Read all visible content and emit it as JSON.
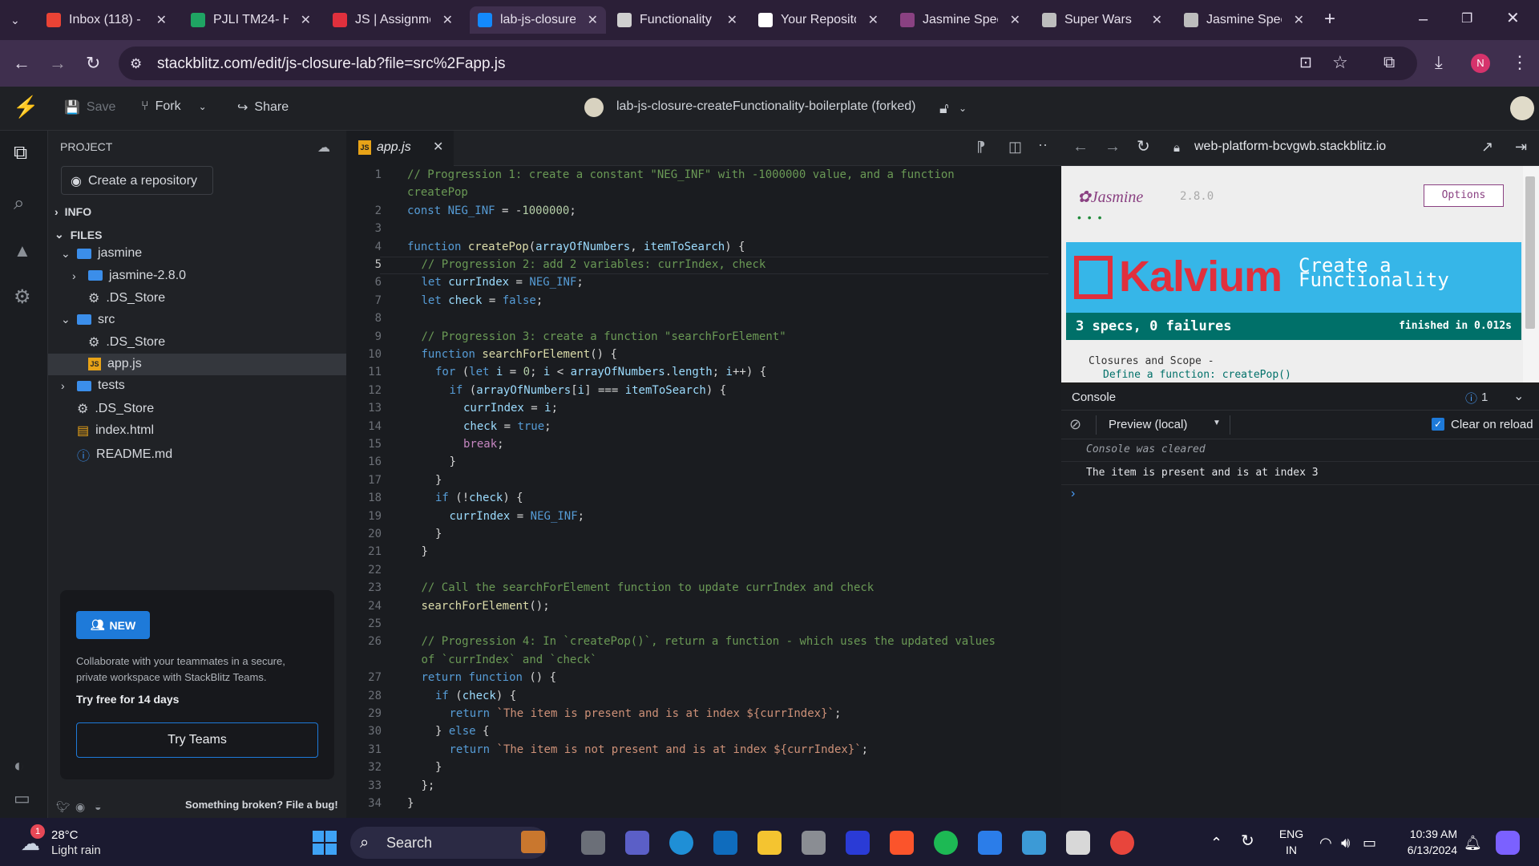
{
  "browser": {
    "tabs": [
      {
        "title": "Inbox (118) -",
        "icon": "gmail-icon",
        "color": "#ea4335"
      },
      {
        "title": "PJLI TM24- H",
        "icon": "sheets-icon",
        "color": "#1fa463"
      },
      {
        "title": "JS | Assignme",
        "icon": "kalvium-icon",
        "color": "#e0303d"
      },
      {
        "title": "lab-js-closure",
        "icon": "stackblitz-icon",
        "color": "#1389fd",
        "active": true
      },
      {
        "title": "Functionality",
        "icon": "chatgpt-icon",
        "color": "#cfcfcf"
      },
      {
        "title": "Your Reposito",
        "icon": "github-icon",
        "color": "#ffffff"
      },
      {
        "title": "Jasmine Spec",
        "icon": "jasmine-icon",
        "color": "#8a4182"
      },
      {
        "title": "Super Wars",
        "icon": "globe-icon",
        "color": "#bdbdbd"
      },
      {
        "title": "Jasmine Spec",
        "icon": "globe-icon",
        "color": "#bdbdbd"
      }
    ],
    "url": "stackblitz.com/edit/js-closure-lab?file=src%2Fapp.js",
    "profile_initial": "N"
  },
  "stackblitz": {
    "save_label": "Save",
    "fork_label": "Fork",
    "share_label": "Share",
    "project_title": "lab-js-closure-createFunctionality-boilerplate (forked)"
  },
  "sidebar": {
    "project_label": "PROJECT",
    "create_repo_label": "Create a repository",
    "info_label": "INFO",
    "files_label": "FILES",
    "tree": [
      {
        "name": "jasmine",
        "type": "folder",
        "depth": 1,
        "open": true
      },
      {
        "name": "jasmine-2.8.0",
        "type": "folder",
        "depth": 2,
        "open": false
      },
      {
        "name": ".DS_Store",
        "type": "gear",
        "depth": 2
      },
      {
        "name": "src",
        "type": "folder",
        "depth": 1,
        "open": true
      },
      {
        "name": ".DS_Store",
        "type": "gear",
        "depth": 2
      },
      {
        "name": "app.js",
        "type": "js",
        "depth": 2,
        "selected": true
      },
      {
        "name": "tests",
        "type": "folder",
        "depth": 1,
        "open": false
      },
      {
        "name": ".DS_Store",
        "type": "gear",
        "depth": 1
      },
      {
        "name": "index.html",
        "type": "html",
        "depth": 1
      },
      {
        "name": "README.md",
        "type": "info",
        "depth": 1
      }
    ],
    "promo": {
      "badge": "NEW",
      "text": "Collaborate with your teammates in a secure, private workspace with StackBlitz Teams.",
      "trial": "Try free for 14 days",
      "button": "Try Teams"
    },
    "footer_link": "Something broken? File a bug!"
  },
  "editor": {
    "tab_label": "app.js",
    "lines": [
      {
        "n": "1",
        "t": "// Progression 1: create a constant \"NEG_INF\" with -1000000 value, and a function",
        "c": "cm",
        "i": 0
      },
      {
        "n": "",
        "t": "createPop",
        "c": "cm",
        "i": 0
      },
      {
        "n": "2",
        "t": "const NEG_INF = -1000000;",
        "c": "code",
        "i": 0
      },
      {
        "n": "3",
        "t": "",
        "c": "code",
        "i": 0
      },
      {
        "n": "4",
        "t": "function createPop(arrayOfNumbers, itemToSearch) {",
        "c": "code",
        "i": 0
      },
      {
        "n": "5",
        "t": "// Progression 2: add 2 variables: currIndex, check",
        "c": "cm",
        "i": 1
      },
      {
        "n": "6",
        "t": "let currIndex = NEG_INF;",
        "c": "code",
        "i": 1
      },
      {
        "n": "7",
        "t": "let check = false;",
        "c": "code",
        "i": 1
      },
      {
        "n": "8",
        "t": "",
        "c": "code",
        "i": 1
      },
      {
        "n": "9",
        "t": "// Progression 3: create a function \"searchForElement\"",
        "c": "cm",
        "i": 1
      },
      {
        "n": "10",
        "t": "function searchForElement() {",
        "c": "code",
        "i": 1
      },
      {
        "n": "11",
        "t": "for (let i = 0; i < arrayOfNumbers.length; i++) {",
        "c": "code",
        "i": 2
      },
      {
        "n": "12",
        "t": "if (arrayOfNumbers[i] === itemToSearch) {",
        "c": "code",
        "i": 3
      },
      {
        "n": "13",
        "t": "currIndex = i;",
        "c": "code",
        "i": 4
      },
      {
        "n": "14",
        "t": "check = true;",
        "c": "code",
        "i": 4
      },
      {
        "n": "15",
        "t": "break;",
        "c": "ctl",
        "i": 4
      },
      {
        "n": "16",
        "t": "}",
        "c": "code",
        "i": 3
      },
      {
        "n": "17",
        "t": "}",
        "c": "code",
        "i": 2
      },
      {
        "n": "18",
        "t": "if (!check) {",
        "c": "code",
        "i": 2
      },
      {
        "n": "19",
        "t": "currIndex = NEG_INF;",
        "c": "code",
        "i": 3
      },
      {
        "n": "20",
        "t": "}",
        "c": "code",
        "i": 2
      },
      {
        "n": "21",
        "t": "}",
        "c": "code",
        "i": 1
      },
      {
        "n": "22",
        "t": "",
        "c": "code",
        "i": 1
      },
      {
        "n": "23",
        "t": "// Call the searchForElement function to update currIndex and check",
        "c": "cm",
        "i": 1
      },
      {
        "n": "24",
        "t": "searchForElement();",
        "c": "code",
        "i": 1
      },
      {
        "n": "25",
        "t": "",
        "c": "code",
        "i": 1
      },
      {
        "n": "26",
        "t": "// Progression 4: In `createPop()`, return a function - which uses the updated values",
        "c": "cm",
        "i": 1
      },
      {
        "n": "",
        "t": "of `currIndex` and `check`",
        "c": "cm",
        "i": 1
      },
      {
        "n": "27",
        "t": "return function () {",
        "c": "code",
        "i": 1
      },
      {
        "n": "28",
        "t": "if (check) {",
        "c": "code",
        "i": 2
      },
      {
        "n": "29",
        "t": "return `The item is present and is at index ${currIndex}`;",
        "c": "code",
        "i": 3
      },
      {
        "n": "30",
        "t": "} else {",
        "c": "code",
        "i": 2
      },
      {
        "n": "31",
        "t": "return `The item is not present and is at index ${currIndex}`;",
        "c": "code",
        "i": 3
      },
      {
        "n": "32",
        "t": "}",
        "c": "code",
        "i": 2
      },
      {
        "n": "33",
        "t": "};",
        "c": "code",
        "i": 1
      },
      {
        "n": "34",
        "t": "}",
        "c": "code",
        "i": 0
      }
    ]
  },
  "preview": {
    "url": "web-platform-bcvgwb.stackblitz.io",
    "jasmine_logo": "Jasmine",
    "jasmine_version": "2.8.0",
    "options_label": "Options",
    "dots": "• • •",
    "banner_brand": "Kalvium",
    "banner_title_1": "Create a",
    "banner_title_2": "Functionality",
    "summary": "3 specs, 0 failures",
    "finished": "finished in 0.012s",
    "suite": "Closures and Scope -",
    "spec": "Define a function: createPop()"
  },
  "console": {
    "title": "Console",
    "count": "1",
    "source": "Preview (local)",
    "clear_label": "Clear on reload",
    "clear_checked": true,
    "messages": [
      "Console was cleared",
      "The item is present and is at index 3"
    ]
  },
  "taskbar": {
    "temp": "28°C",
    "weather": "Light rain",
    "weather_badge": "1",
    "search": "Search",
    "lang1": "ENG",
    "lang2": "IN",
    "time": "10:39 AM",
    "date": "6/13/2024"
  }
}
